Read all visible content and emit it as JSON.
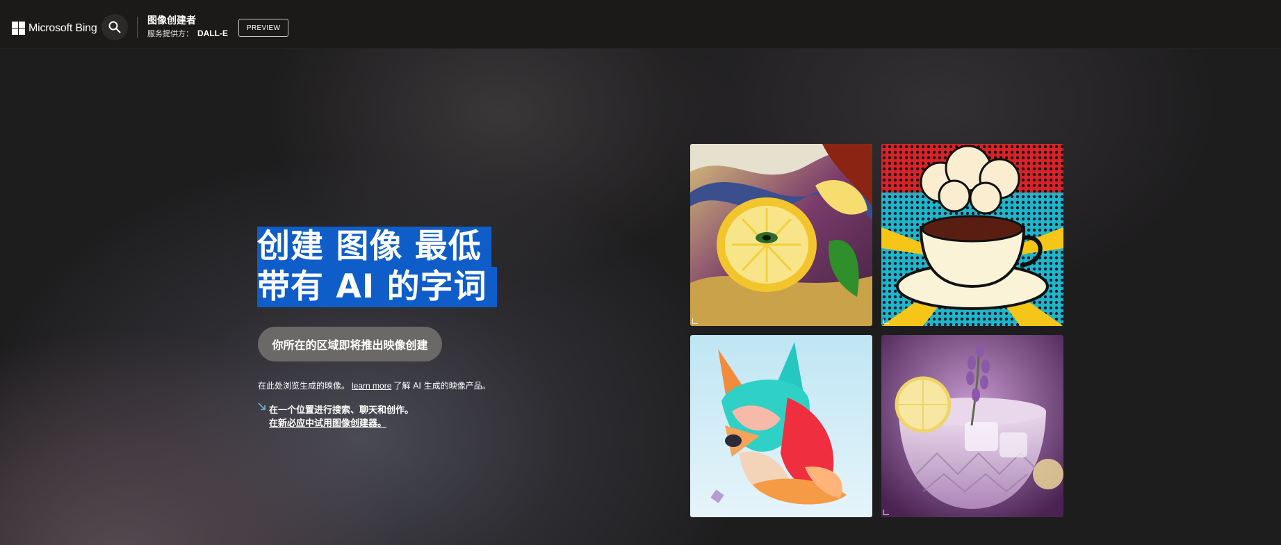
{
  "header": {
    "brand": "Microsoft Bing",
    "product_title": "图像创建者",
    "provider_label": "服务提供方：",
    "provider_name": "DALL-E",
    "badge": "PREVIEW"
  },
  "hero": {
    "headline_line1": "创建 图像 最低",
    "headline_line2": "带有 AI 的字词",
    "cta_label": "你所在的区域即将推出映像创建",
    "info_text_before": "在此处浏览生成的映像。",
    "info_link": "learn more",
    "info_text_after": "了解 AI 生成的映像产品。",
    "promo_line1": "在一个位置进行搜索、聊天和创作。",
    "promo_line2": "在新必应中试用图像创建器。"
  },
  "icons": {
    "search": "search-icon",
    "logo": "microsoft-logo-icon",
    "promo": "arrow-down-right-icon"
  },
  "colors": {
    "header_bg": "#1b1a19",
    "headline_highlight": "#0f5dc9",
    "cta_bg": "#6b6968"
  }
}
